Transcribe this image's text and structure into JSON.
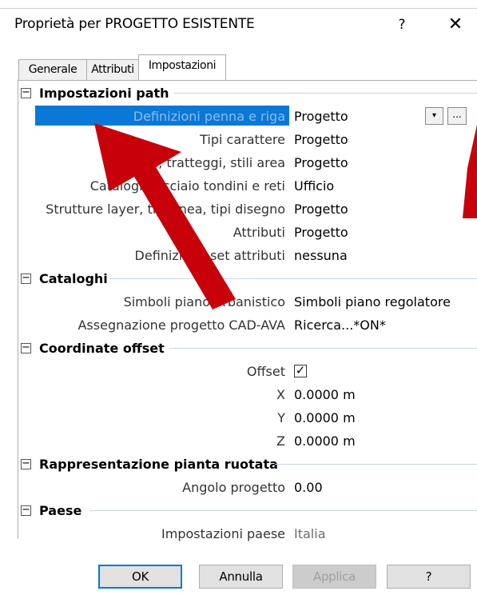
{
  "window": {
    "title": "Proprietà per PROGETTO ESISTENTE",
    "help_label": "?",
    "close_label": "✕"
  },
  "tabs": [
    {
      "label": "Generale",
      "active": false
    },
    {
      "label": "Attributi",
      "active": false
    },
    {
      "label": "Impostazioni",
      "active": true
    }
  ],
  "sections": {
    "path": {
      "title": "Impostazioni path",
      "toggle": "−",
      "rows": [
        {
          "name": "Definizioni penna e riga",
          "value": "Progetto"
        },
        {
          "name": "Tipi carattere",
          "value": "Progetto"
        },
        {
          "name": "Retini, tratteggi, stili area",
          "value": "Progetto"
        },
        {
          "name": "Cataloghi acciaio tondini e reti",
          "value": "Ufficio"
        },
        {
          "name": "Strutture layer, tipi linea, tipi disegno",
          "value": "Progetto"
        },
        {
          "name": "Attributi",
          "value": "Progetto"
        },
        {
          "name": "Definizione set attributi",
          "value": "nessuna"
        }
      ]
    },
    "cataloghi": {
      "title": "Cataloghi",
      "toggle": "−",
      "rows": [
        {
          "name": "Simboli piano urbanistico",
          "value": "Simboli piano regolatore"
        },
        {
          "name": "Assegnazione progetto CAD-AVA",
          "value": "Ricerca...*ON*"
        }
      ]
    },
    "offset": {
      "title": "Coordinate offset",
      "toggle": "−",
      "offset_label": "Offset",
      "offset_checked": true,
      "check_mark": "✓",
      "rows": [
        {
          "name": "X",
          "value": "0.0000 m"
        },
        {
          "name": "Y",
          "value": "0.0000 m"
        },
        {
          "name": "Z",
          "value": "0.0000 m"
        }
      ]
    },
    "rotated": {
      "title": "Rappresentazione pianta ruotata",
      "toggle": "−",
      "rows": [
        {
          "name": "Angolo progetto",
          "value": "0.00"
        }
      ]
    },
    "country": {
      "title": "Paese",
      "toggle": "−",
      "rows": [
        {
          "name": "Impostazioni paese",
          "value": "Italia"
        }
      ]
    }
  },
  "row_buttons": {
    "dropdown_glyph": "▾",
    "ellipsis_label": "..."
  },
  "buttons": {
    "ok": "OK",
    "cancel": "Annulla",
    "apply": "Applica",
    "help": "?"
  },
  "colors": {
    "selection": "#0a78d7",
    "arrow": "#c8000a",
    "section_rule": "#c9d5e6"
  }
}
